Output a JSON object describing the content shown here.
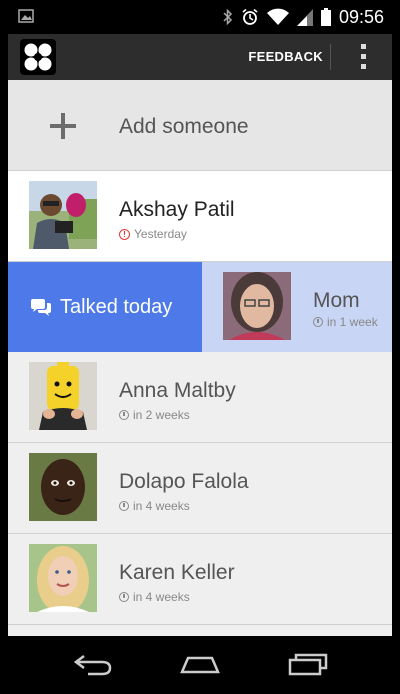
{
  "status_bar": {
    "time": "09:56"
  },
  "app_bar": {
    "feedback_label": "FEEDBACK"
  },
  "add_someone": {
    "label": "Add someone"
  },
  "contacts": [
    {
      "name": "Akshay Patil",
      "status": "Yesterday",
      "status_type": "overdue"
    },
    {
      "name": "Mom",
      "status": "in 1 week",
      "status_type": "upcoming"
    },
    {
      "name": "Anna Maltby",
      "status": "in 2 weeks",
      "status_type": "upcoming"
    },
    {
      "name": "Dolapo Falola",
      "status": "in 4 weeks",
      "status_type": "upcoming"
    },
    {
      "name": "Karen Keller",
      "status": "in 4 weeks",
      "status_type": "upcoming"
    }
  ],
  "swipe_action": {
    "label": "Talked today"
  },
  "colors": {
    "swipe_blue": "#4d7ae8",
    "swipe_card": "#c9d5f5",
    "overdue_red": "#e53935"
  }
}
